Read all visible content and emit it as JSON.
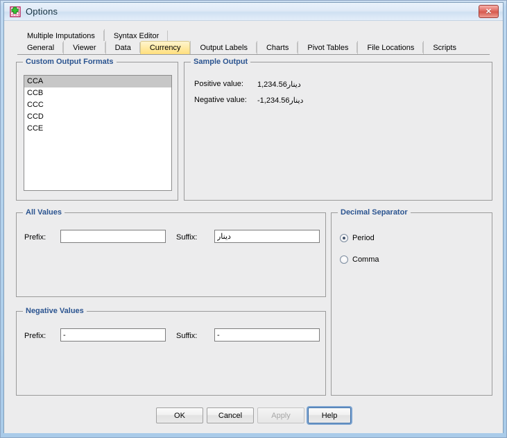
{
  "window": {
    "title": "Options",
    "icon": "spss-app-icon",
    "close_label": "✕"
  },
  "tabs": {
    "top_row": [
      {
        "label": "Multiple Imputations"
      },
      {
        "label": "Syntax Editor"
      }
    ],
    "bottom_row": [
      {
        "label": "General"
      },
      {
        "label": "Viewer"
      },
      {
        "label": "Data"
      },
      {
        "label": "Currency"
      },
      {
        "label": "Output Labels"
      },
      {
        "label": "Charts"
      },
      {
        "label": "Pivot Tables"
      },
      {
        "label": "File Locations"
      },
      {
        "label": "Scripts"
      }
    ],
    "active": "Currency"
  },
  "custom_output_formats": {
    "title": "Custom Output Formats",
    "items": [
      {
        "label": "CCA",
        "selected": true
      },
      {
        "label": "CCB",
        "selected": false
      },
      {
        "label": "CCC",
        "selected": false
      },
      {
        "label": "CCD",
        "selected": false
      },
      {
        "label": "CCE",
        "selected": false
      }
    ]
  },
  "sample_output": {
    "title": "Sample Output",
    "positive_label": "Positive value:",
    "positive_value": "1,234.56دينار",
    "negative_label": "Negative value:",
    "negative_value": "-1,234.56دينار"
  },
  "all_values": {
    "title": "All Values",
    "prefix_label": "Prefix:",
    "prefix_value": "",
    "suffix_label": "Suffix:",
    "suffix_value": "دينار"
  },
  "negative_values": {
    "title": "Negative Values",
    "prefix_label": "Prefix:",
    "prefix_value": "-",
    "suffix_label": "Suffix:",
    "suffix_value": "-"
  },
  "decimal_separator": {
    "title": "Decimal Separator",
    "options": [
      {
        "label": "Period",
        "selected": true
      },
      {
        "label": "Comma",
        "selected": false
      }
    ]
  },
  "buttons": {
    "ok": "OK",
    "cancel": "Cancel",
    "apply": "Apply",
    "help": "Help"
  },
  "colors": {
    "group_title": "#2b5490",
    "active_tab": "#ffe09a",
    "selection": "#c7c7c7",
    "close_button": "#d65b50"
  }
}
